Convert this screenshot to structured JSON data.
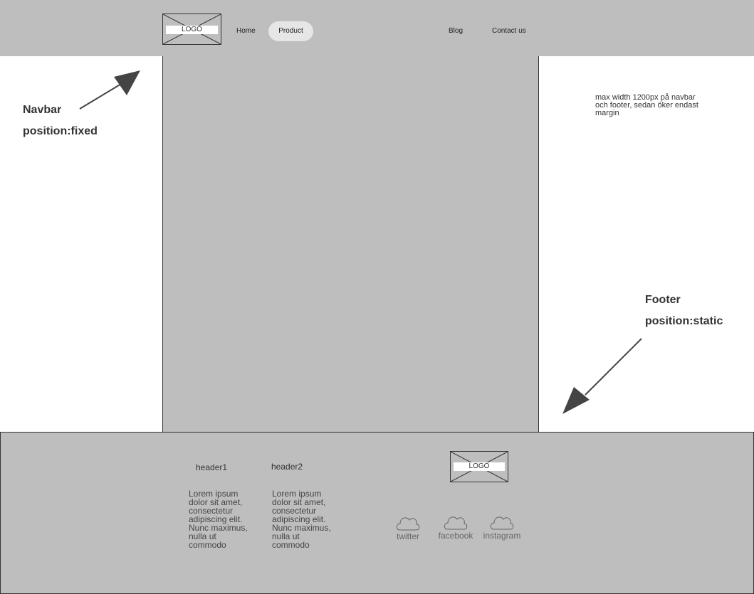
{
  "navbar": {
    "logo": "LOGO",
    "links": [
      "Home",
      "Product",
      "Blog",
      "Contact us"
    ]
  },
  "annotations": {
    "navbar_title": "Navbar",
    "navbar_position": "position:fixed",
    "footer_title": "Footer",
    "footer_position": "position:static",
    "max_width_note": [
      "max width 1200px på navbar",
      "och footer, sedan öker endast",
      "margin"
    ]
  },
  "footer": {
    "columns": [
      {
        "header": "header1",
        "lines": [
          "Lorem ipsum",
          "dolor sit amet,",
          "consectetur",
          "adipiscing elit.",
          "Nunc maximus,",
          "nulla ut",
          "commodo"
        ]
      },
      {
        "header": "header2",
        "lines": [
          "Lorem ipsum",
          "dolor sit amet,",
          "consectetur",
          "adipiscing elit.",
          "Nunc maximus,",
          "nulla ut",
          "commodo"
        ]
      }
    ],
    "logo": "LOGO",
    "social": [
      "twitter",
      "facebook",
      "instagram"
    ]
  },
  "colors": {
    "placeholder_gray": "#bebebe",
    "arrow": "#444444",
    "outline": "#333333"
  }
}
